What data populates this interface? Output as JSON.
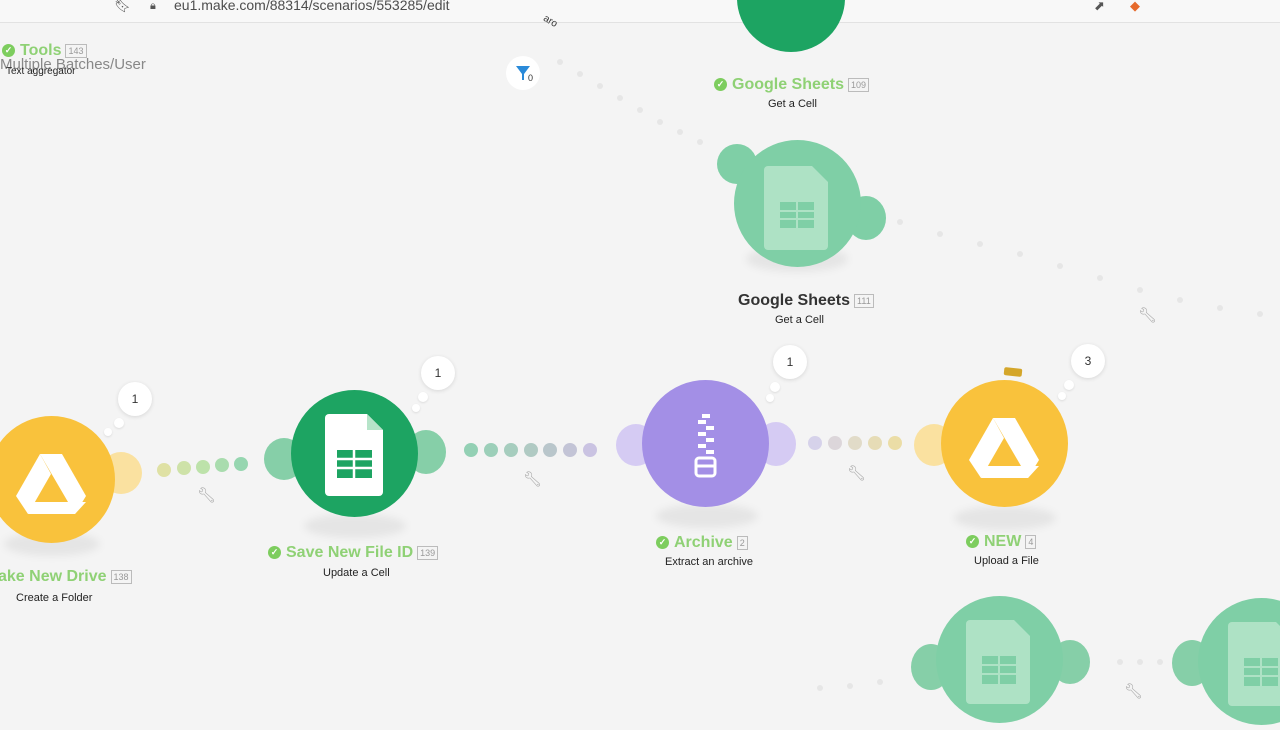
{
  "browser": {
    "url": "eu1.make.com/88314/scenarios/553285/edit",
    "bookmark_icon": "bookmark-icon",
    "lock_icon": "lock-icon",
    "share_icon": "share-icon",
    "extension_icon": "brave-shield-icon"
  },
  "top_left": {
    "tools_title": "Tools",
    "tools_num": "143",
    "tools_sub": "Text aggregator",
    "route_label": "Multiple Batches/User"
  },
  "filter": {
    "count": "0",
    "icon": "filter-icon"
  },
  "modules": {
    "gs_top": {
      "title": "Google Sheets",
      "num": "109",
      "sub": "Get a Cell"
    },
    "gs_mid": {
      "title": "Google Sheets",
      "num": "111",
      "sub": "Get a Cell"
    },
    "drive_left": {
      "title": "ake New Drive",
      "num": "138",
      "sub": "Create a Folder",
      "bubble": "1"
    },
    "save_file": {
      "title": "Save New File ID",
      "num": "139",
      "sub": "Update a Cell",
      "bubble": "1"
    },
    "archive": {
      "title": "Archive",
      "num": "2",
      "sub": "Extract an archive",
      "bubble": "1"
    },
    "new_upload": {
      "title": "NEW",
      "num": "4",
      "sub": "Upload a File",
      "bubble": "3"
    }
  },
  "colors": {
    "sheets_green": "#1da462",
    "sheets_light": "#7fcfa6",
    "drive_yellow": "#f9c23c",
    "archive_purple": "#a38fe6",
    "success_green": "#7dcd5e"
  }
}
